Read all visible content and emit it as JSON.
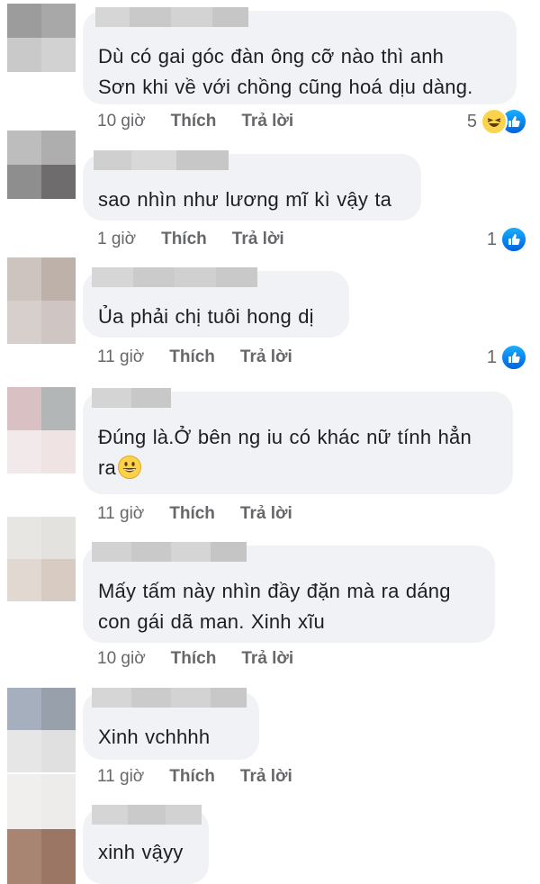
{
  "comments": [
    {
      "text": "Dù có gai góc đàn ông cỡ nào thì anh\nSơn khi về với chồng cũng hoá dịu dàng.",
      "time": "10 giờ",
      "like_label": "Thích",
      "reply_label": "Trả lời",
      "reaction_count": "5",
      "reactions": [
        "haha-icon",
        "like-icon"
      ]
    },
    {
      "text": "sao nhìn như lương mĩ kì vậy ta",
      "time": "1 giờ",
      "like_label": "Thích",
      "reply_label": "Trả lời",
      "reaction_count": "1",
      "reactions": [
        "like-icon"
      ]
    },
    {
      "text": "Ủa phải chị tuôi hong dị",
      "time": "11 giờ",
      "like_label": "Thích",
      "reply_label": "Trả lời",
      "reaction_count": "1",
      "reactions": [
        "like-icon"
      ]
    },
    {
      "text_line1": "Đúng là.Ở bên ng iu có khác nữ tính hẳn",
      "text_line2": "ra",
      "emoji": "grinning-face-emoji",
      "time": "11 giờ",
      "like_label": "Thích",
      "reply_label": "Trả lời"
    },
    {
      "text": "Mấy tấm này nhìn đầy đặn mà ra dáng\ncon gái dã man.  Xinh xĩu",
      "time": "10 giờ",
      "like_label": "Thích",
      "reply_label": "Trả lời"
    },
    {
      "text": "Xinh vchhhh",
      "time": "11 giờ",
      "like_label": "Thích",
      "reply_label": "Trả lời"
    },
    {
      "text": "xinh vậyy"
    }
  ],
  "colors": {
    "bubble": "#f0f2f5",
    "text": "#1c1e21",
    "meta": "#65676b",
    "like_blue": "#1877f2"
  }
}
